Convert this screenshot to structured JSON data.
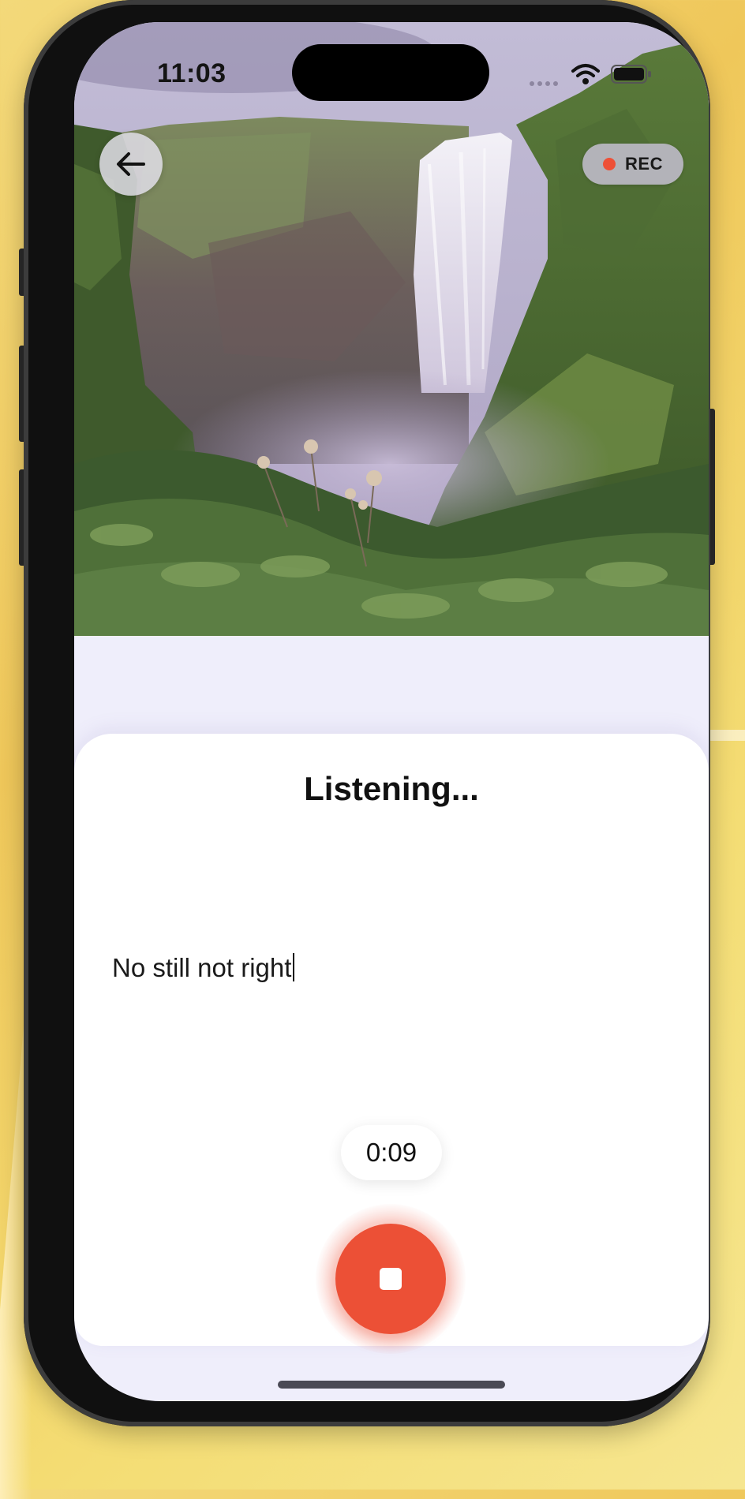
{
  "status_bar": {
    "time": "11:03"
  },
  "header": {
    "back_icon": "arrow-left-icon",
    "rec_label": "REC",
    "rec_color": "#ee5037"
  },
  "main": {
    "heading": "Listening...",
    "transcript": "No still not right",
    "timer": "0:09",
    "stop_icon": "stop-icon",
    "accent": "#ec5036"
  }
}
